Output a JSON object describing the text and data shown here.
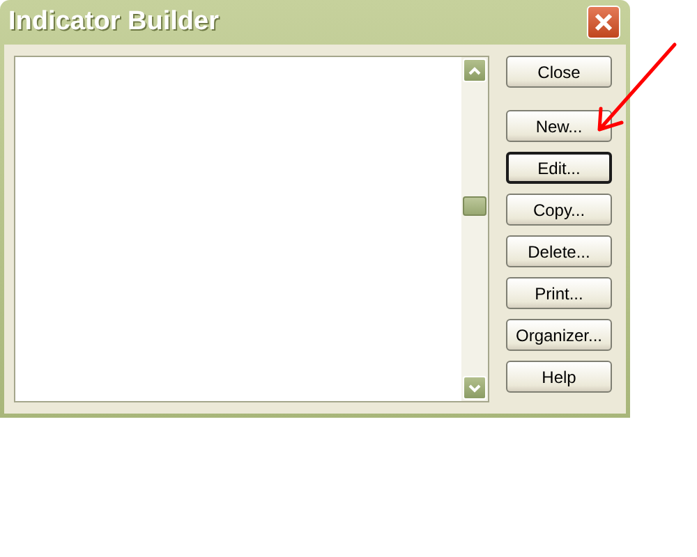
{
  "window": {
    "title": "Indicator Builder"
  },
  "buttons": [
    {
      "label": "Close",
      "default": false
    },
    {
      "label": "New...",
      "default": false
    },
    {
      "label": "Edit...",
      "default": true
    },
    {
      "label": "Copy...",
      "default": false
    },
    {
      "label": "Delete...",
      "default": false
    },
    {
      "label": "Print...",
      "default": false
    },
    {
      "label": "Organizer...",
      "default": false
    },
    {
      "label": "Help",
      "default": false
    }
  ]
}
